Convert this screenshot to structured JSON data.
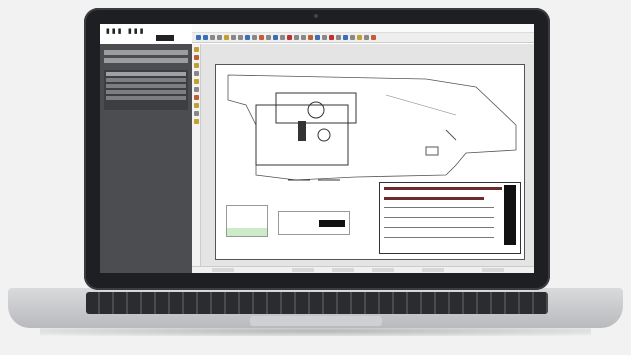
{
  "app": {
    "menu_title": "",
    "colors": {
      "panel": "#4b4d50",
      "title_bar": "#6e2b2b",
      "accent": "#3a6fb5"
    }
  },
  "left_panel": {
    "logo_icon": "app-logo-icon",
    "rows": 5
  },
  "drawing": {
    "room_label": "",
    "toolbar_icons": [
      "line-icon",
      "arc-icon",
      "circle-icon",
      "rect-icon",
      "text-icon",
      "move-icon",
      "copy-icon",
      "rotate-icon",
      "trim-icon",
      "zoom-icon",
      "pan-icon",
      "layer-icon",
      "print-icon",
      "save-icon",
      "undo-icon",
      "redo-icon"
    ]
  }
}
